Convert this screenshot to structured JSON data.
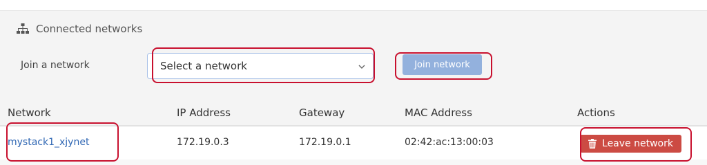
{
  "panel": {
    "title": "Connected networks",
    "header_icon": "sitemap-icon"
  },
  "join": {
    "label": "Join a network",
    "select_value": "Select a network",
    "button_label": "Join network"
  },
  "table": {
    "columns": [
      "Network",
      "IP Address",
      "Gateway",
      "MAC Address",
      "Actions"
    ],
    "rows": [
      {
        "network": "mystack1_xjynet",
        "ip_address": "172.19.0.3",
        "gateway": "172.19.0.1",
        "mac_address": "02:42:ac:13:00:03",
        "action_label": "Leave network"
      }
    ]
  },
  "colors": {
    "link": "#2e66b3",
    "primary_button": "#93b1dd",
    "danger_button": "#cc4b43",
    "highlight": "#c8102e"
  }
}
